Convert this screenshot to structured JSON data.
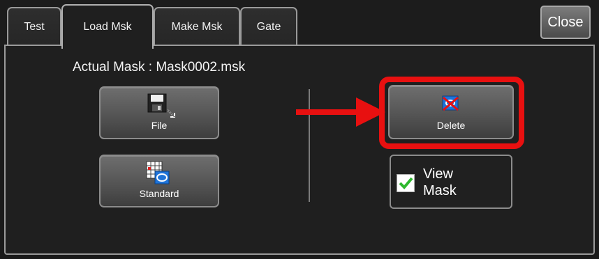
{
  "tabs": [
    {
      "label": "Test",
      "active": false
    },
    {
      "label": "Load Msk",
      "active": true
    },
    {
      "label": "Make Msk",
      "active": false
    },
    {
      "label": "Gate",
      "active": false
    }
  ],
  "close_label": "Close",
  "actual_mask": {
    "label": "Actual Mask : Mask0002.msk"
  },
  "buttons": {
    "file": {
      "label": "File",
      "icon": "floppy-disk-icon"
    },
    "standard": {
      "label": "Standard",
      "icon": "standard-mask-icon"
    },
    "delete": {
      "label": "Delete",
      "icon": "delete-mask-icon"
    }
  },
  "view_mask": {
    "line1": "View",
    "line2": "Mask",
    "checked": true
  },
  "colors": {
    "highlight": "#e81010",
    "check": "#2eb82e",
    "panel": "#1f1f1f",
    "border": "#9a9a9a"
  }
}
